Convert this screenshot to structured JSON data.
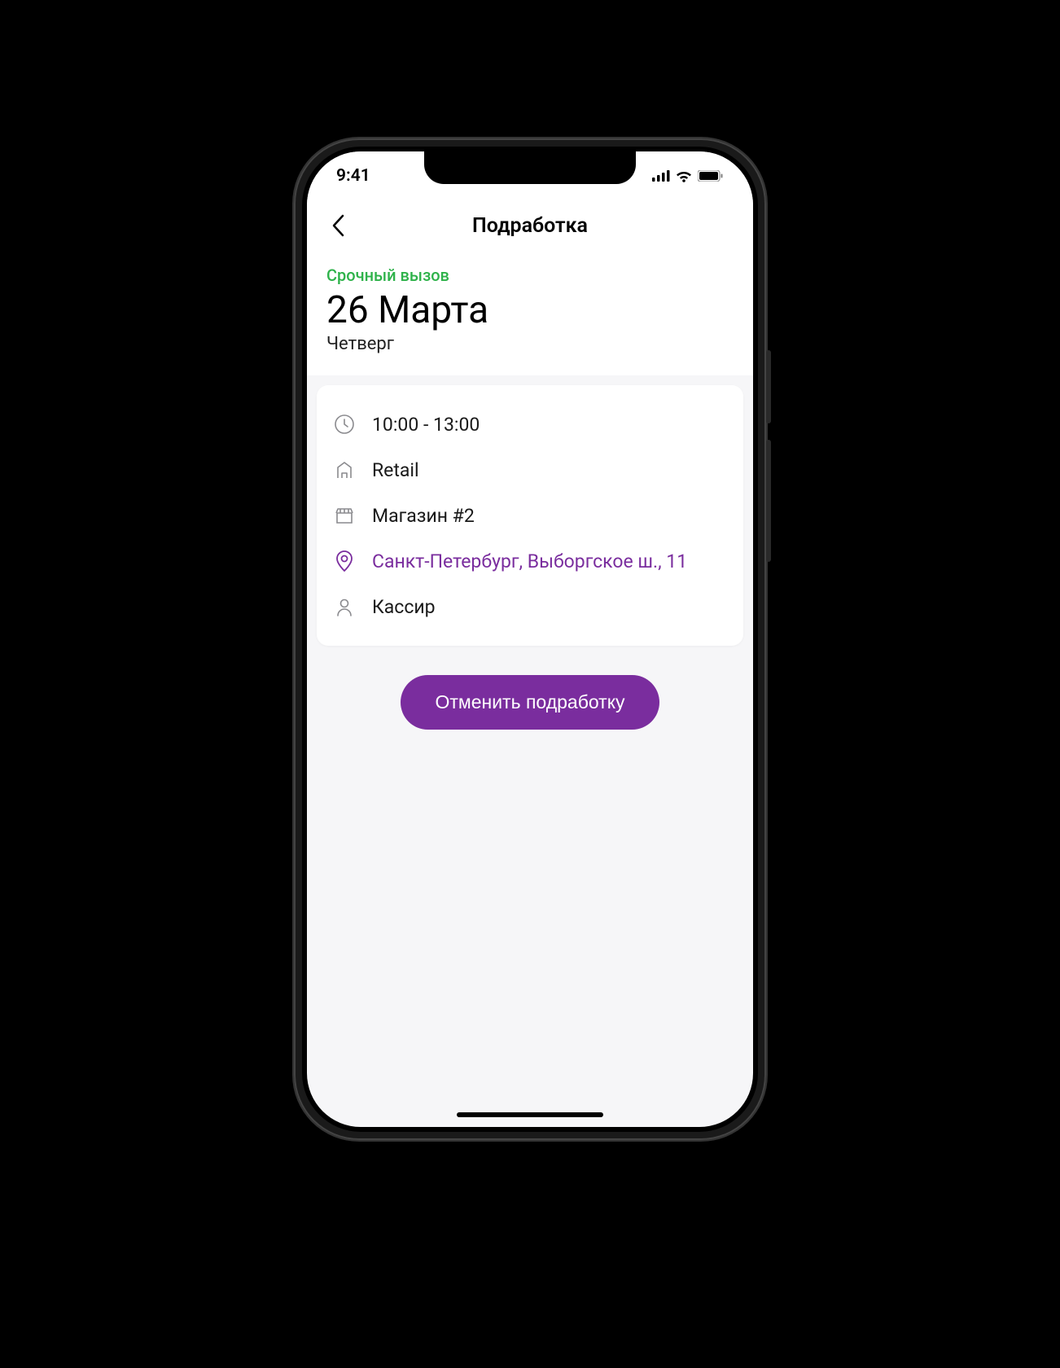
{
  "status": {
    "time": "9:41"
  },
  "nav": {
    "title": "Подработка"
  },
  "header": {
    "urgent_label": "Срочный вызов",
    "date": "26  Марта",
    "weekday": "Четверг"
  },
  "details": {
    "time": "10:00 - 13:00",
    "company": "Retail",
    "store": "Магазин #2",
    "address": "Санкт-Петербург, Выборгское ш., 11",
    "role": "Кассир"
  },
  "actions": {
    "cancel_label": "Отменить подработку"
  }
}
